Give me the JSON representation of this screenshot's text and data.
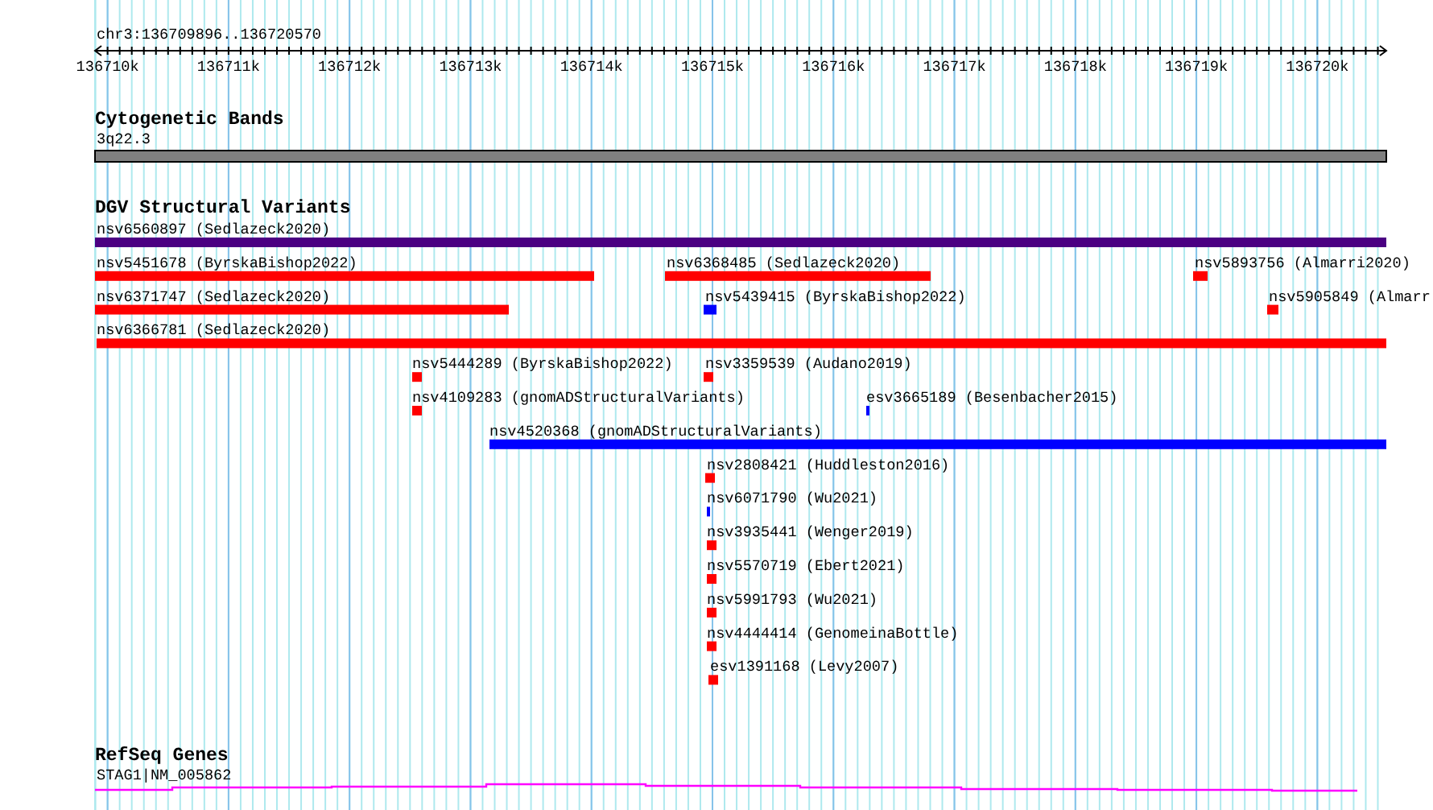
{
  "ruler": {
    "location": "chr3:136709896..136720570",
    "ticks": [
      "136710k",
      "136711k",
      "136712k",
      "136713k",
      "136714k",
      "136715k",
      "136716k",
      "136717k",
      "136718k",
      "136719k",
      "136720k"
    ]
  },
  "tracks": [
    {
      "kind": "cytoband",
      "title": "Cytogenetic Bands",
      "features": [
        {
          "label": "3q22.3"
        }
      ]
    },
    {
      "kind": "variants",
      "title": "DGV Structural Variants",
      "features": [
        {
          "label": "nsv6560897 (Sedlazeck2020)",
          "color": "#4b0082"
        },
        {
          "label": "nsv5451678 (ByrskaBishop2022)",
          "color": "#ff0000"
        },
        {
          "label": "nsv6368485 (Sedlazeck2020)",
          "color": "#ff0000"
        },
        {
          "label": "nsv5893756 (Almarri2020)",
          "color": "#ff0000"
        },
        {
          "label": "nsv6371747 (Sedlazeck2020)",
          "color": "#ff0000"
        },
        {
          "label": "nsv5439415 (ByrskaBishop2022)",
          "color": "#0000ff"
        },
        {
          "label": "nsv5905849 (Almarr",
          "color": "#ff0000"
        },
        {
          "label": "nsv6366781 (Sedlazeck2020)",
          "color": "#ff0000"
        },
        {
          "label": "nsv5444289 (ByrskaBishop2022)",
          "color": "#ff0000"
        },
        {
          "label": "nsv3359539 (Audano2019)",
          "color": "#ff0000"
        },
        {
          "label": "nsv4109283 (gnomADStructuralVariants)",
          "color": "#ff0000"
        },
        {
          "label": "esv3665189 (Besenbacher2015)",
          "color": "#0000ff"
        },
        {
          "label": "nsv4520368 (gnomADStructuralVariants)",
          "color": "#0000ff"
        },
        {
          "label": "nsv2808421 (Huddleston2016)",
          "color": "#ff0000"
        },
        {
          "label": "nsv6071790 (Wu2021)",
          "color": "#0000ff"
        },
        {
          "label": "nsv3935441 (Wenger2019)",
          "color": "#ff0000"
        },
        {
          "label": "nsv5570719 (Ebert2021)",
          "color": "#ff0000"
        },
        {
          "label": "nsv5991793 (Wu2021)",
          "color": "#ff0000"
        },
        {
          "label": "nsv4444414 (GenomeinaBottle)",
          "color": "#ff0000"
        },
        {
          "label": "esv1391168 (Levy2007)",
          "color": "#ff0000"
        }
      ]
    },
    {
      "kind": "genes",
      "title": "RefSeq Genes",
      "features": [
        {
          "label": "STAG1|NM_005862"
        }
      ]
    }
  ]
}
